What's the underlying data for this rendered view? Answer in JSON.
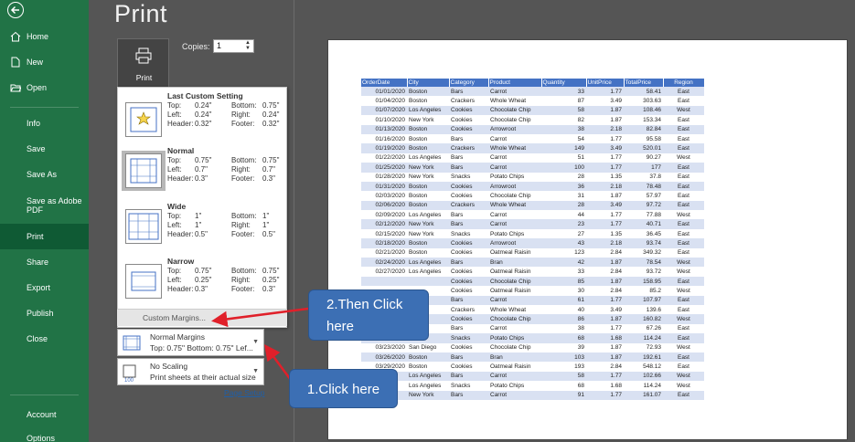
{
  "nav": {
    "items": [
      {
        "label": "Home",
        "icon": "home-icon"
      },
      {
        "label": "New",
        "icon": "new-doc-icon"
      },
      {
        "label": "Open",
        "icon": "open-folder-icon"
      },
      {
        "label": "Info"
      },
      {
        "label": "Save"
      },
      {
        "label": "Save As"
      },
      {
        "label": "Save as Adobe PDF"
      },
      {
        "label": "Print",
        "active": true
      },
      {
        "label": "Share"
      },
      {
        "label": "Export"
      },
      {
        "label": "Publish"
      },
      {
        "label": "Close"
      },
      {
        "label": "Account"
      },
      {
        "label": "Options"
      }
    ]
  },
  "page_title": "Print",
  "print_button": {
    "label": "Print"
  },
  "copies": {
    "label": "Copies:",
    "value": "1"
  },
  "margins": {
    "options": [
      {
        "name": "Last Custom Setting",
        "top": "0.24\"",
        "bottom": "0.75\"",
        "left": "0.24\"",
        "right": "0.24\"",
        "header": "0.32\"",
        "footer": "0.32\""
      },
      {
        "name": "Normal",
        "top": "0.75\"",
        "bottom": "0.75\"",
        "left": "0.7\"",
        "right": "0.7\"",
        "header": "0.3\"",
        "footer": "0.3\"",
        "selected": true
      },
      {
        "name": "Wide",
        "top": "1\"",
        "bottom": "1\"",
        "left": "1\"",
        "right": "1\"",
        "header": "0.5\"",
        "footer": "0.5\""
      },
      {
        "name": "Narrow",
        "top": "0.75\"",
        "bottom": "0.75\"",
        "left": "0.25\"",
        "right": "0.25\"",
        "header": "0.3\"",
        "footer": "0.3\""
      }
    ],
    "labels": {
      "top": "Top:",
      "bottom": "Bottom:",
      "left": "Left:",
      "right": "Right:",
      "header": "Header:",
      "footer": "Footer:"
    },
    "custom_label": "Custom Margins..."
  },
  "margins_dropdown": {
    "title": "Normal Margins",
    "subtitle": "Top: 0.75\" Bottom: 0.75\" Lef..."
  },
  "scaling_dropdown": {
    "title": "No Scaling",
    "subtitle": "Print sheets at their actual size"
  },
  "page_setup": "Page Setup",
  "callouts": {
    "click_here": "1.Click here",
    "then_click_line1": "2.Then Click",
    "then_click_line2": "here"
  },
  "colors": {
    "nav_green": "#217346",
    "header_blue": "#4472c4",
    "band_blue": "#d9e1f2",
    "callout_blue": "#3c6fb4",
    "arrow_red": "#e0202a"
  },
  "sheet": {
    "headers": [
      "OrderDate",
      "City",
      "Category",
      "Product",
      "Quantity",
      "UnitPrice",
      "TotalPrice",
      "Region"
    ],
    "rows": [
      [
        "01/01/2020",
        "Boston",
        "Bars",
        "Carrot",
        "33",
        "1.77",
        "58.41",
        "East"
      ],
      [
        "01/04/2020",
        "Boston",
        "Crackers",
        "Whole Wheat",
        "87",
        "3.49",
        "303.63",
        "East"
      ],
      [
        "01/07/2020",
        "Los Angeles",
        "Cookies",
        "Chocolate Chip",
        "58",
        "1.87",
        "108.46",
        "West"
      ],
      [
        "01/10/2020",
        "New York",
        "Cookies",
        "Chocolate Chip",
        "82",
        "1.87",
        "153.34",
        "East"
      ],
      [
        "01/13/2020",
        "Boston",
        "Cookies",
        "Arrowroot",
        "38",
        "2.18",
        "82.84",
        "East"
      ],
      [
        "01/16/2020",
        "Boston",
        "Bars",
        "Carrot",
        "54",
        "1.77",
        "95.58",
        "East"
      ],
      [
        "01/19/2020",
        "Boston",
        "Crackers",
        "Whole Wheat",
        "149",
        "3.49",
        "520.01",
        "East"
      ],
      [
        "01/22/2020",
        "Los Angeles",
        "Bars",
        "Carrot",
        "51",
        "1.77",
        "90.27",
        "West"
      ],
      [
        "01/25/2020",
        "New York",
        "Bars",
        "Carrot",
        "100",
        "1.77",
        "177",
        "East"
      ],
      [
        "01/28/2020",
        "New York",
        "Snacks",
        "Potato Chips",
        "28",
        "1.35",
        "37.8",
        "East"
      ],
      [
        "01/31/2020",
        "Boston",
        "Cookies",
        "Arrowroot",
        "36",
        "2.18",
        "78.48",
        "East"
      ],
      [
        "02/03/2020",
        "Boston",
        "Cookies",
        "Chocolate Chip",
        "31",
        "1.87",
        "57.97",
        "East"
      ],
      [
        "02/06/2020",
        "Boston",
        "Crackers",
        "Whole Wheat",
        "28",
        "3.49",
        "97.72",
        "East"
      ],
      [
        "02/09/2020",
        "Los Angeles",
        "Bars",
        "Carrot",
        "44",
        "1.77",
        "77.88",
        "West"
      ],
      [
        "02/12/2020",
        "New York",
        "Bars",
        "Carrot",
        "23",
        "1.77",
        "40.71",
        "East"
      ],
      [
        "02/15/2020",
        "New York",
        "Snacks",
        "Potato Chips",
        "27",
        "1.35",
        "36.45",
        "East"
      ],
      [
        "02/18/2020",
        "Boston",
        "Cookies",
        "Arrowroot",
        "43",
        "2.18",
        "93.74",
        "East"
      ],
      [
        "02/21/2020",
        "Boston",
        "Cookies",
        "Oatmeal Raisin",
        "123",
        "2.84",
        "349.32",
        "East"
      ],
      [
        "02/24/2020",
        "Los Angeles",
        "Bars",
        "Bran",
        "42",
        "1.87",
        "78.54",
        "West"
      ],
      [
        "02/27/2020",
        "Los Angeles",
        "Cookies",
        "Oatmeal Raisin",
        "33",
        "2.84",
        "93.72",
        "West"
      ],
      [
        "",
        "",
        "Cookies",
        "Chocolate Chip",
        "85",
        "1.87",
        "158.95",
        "East"
      ],
      [
        "",
        "",
        "Cookies",
        "Oatmeal Raisin",
        "30",
        "2.84",
        "85.2",
        "West"
      ],
      [
        "",
        "",
        "Bars",
        "Carrot",
        "61",
        "1.77",
        "107.97",
        "East"
      ],
      [
        "",
        "",
        "Crackers",
        "Whole Wheat",
        "40",
        "3.49",
        "139.6",
        "East"
      ],
      [
        "",
        "",
        "Cookies",
        "Chocolate Chip",
        "86",
        "1.87",
        "160.82",
        "West"
      ],
      [
        "",
        "",
        "Bars",
        "Carrot",
        "38",
        "1.77",
        "67.26",
        "East"
      ],
      [
        "",
        "",
        "Snacks",
        "Potato Chips",
        "68",
        "1.68",
        "114.24",
        "East"
      ],
      [
        "03/23/2020",
        "San Diego",
        "Cookies",
        "Chocolate Chip",
        "39",
        "1.87",
        "72.93",
        "West"
      ],
      [
        "03/26/2020",
        "Boston",
        "Bars",
        "Bran",
        "103",
        "1.87",
        "192.61",
        "East"
      ],
      [
        "03/29/2020",
        "Boston",
        "Cookies",
        "Oatmeal Raisin",
        "193",
        "2.84",
        "548.12",
        "East"
      ],
      [
        "",
        "Los Angeles",
        "Bars",
        "Carrot",
        "58",
        "1.77",
        "102.66",
        "West"
      ],
      [
        "",
        "Los Angeles",
        "Snacks",
        "Potato Chips",
        "68",
        "1.68",
        "114.24",
        "West"
      ],
      [
        "",
        "New York",
        "Bars",
        "Carrot",
        "91",
        "1.77",
        "161.07",
        "East"
      ]
    ]
  }
}
